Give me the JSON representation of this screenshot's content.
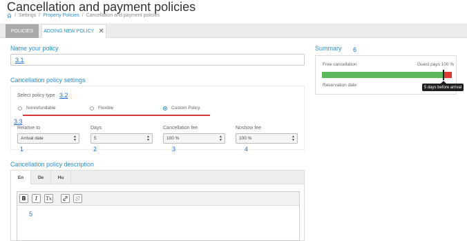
{
  "page": {
    "title": "Cancellation and payment policies",
    "breadcrumb": [
      "Settings",
      "Property Policies",
      "Cancellation and payment policies"
    ]
  },
  "tabs": {
    "policies": "POLICIES",
    "adding": "ADDING NEW POLICY",
    "close_glyph": "✕"
  },
  "name_section": {
    "title": "Name your policy",
    "annotation": "3.1",
    "value": ""
  },
  "settings": {
    "title": "Cancellation policy settings",
    "policy_type_label": "Select policy type",
    "policy_type_annotation": "3.2",
    "radio_annotation": "3.3",
    "options": [
      {
        "label": "Nonrefundable",
        "selected": false
      },
      {
        "label": "Flexible",
        "selected": false
      },
      {
        "label": "Custom Policy",
        "selected": true
      }
    ],
    "fields": [
      {
        "label": "Relative to",
        "value": "Arrival date",
        "annotation": "1"
      },
      {
        "label": "Days",
        "value": "5",
        "annotation": "2"
      },
      {
        "label": "Cancellation fee",
        "value": "100 %",
        "annotation": "3"
      },
      {
        "label": "Noshow fee",
        "value": "100 %",
        "annotation": "4"
      }
    ]
  },
  "description": {
    "title": "Cancellation policy description",
    "languages": [
      "En",
      "De",
      "Hu"
    ],
    "active_language": "En",
    "editor_annotation": "5",
    "toolbar": {
      "bold": "B",
      "italic": "I",
      "clear_format": "Tx",
      "link": "link-icon",
      "unlink": "unlink-icon"
    }
  },
  "summary": {
    "title": "Summary",
    "annotation": "6",
    "free_label": "Free cancellation",
    "pay_label": "Guest pays 100 %",
    "reservation_label": "Reservation date",
    "tooltip": "5 days before arrival",
    "free_fraction": 0.94,
    "colors": {
      "free": "#5cb85c",
      "pay": "#e03a2e",
      "accent": "#2a8fd6"
    }
  }
}
